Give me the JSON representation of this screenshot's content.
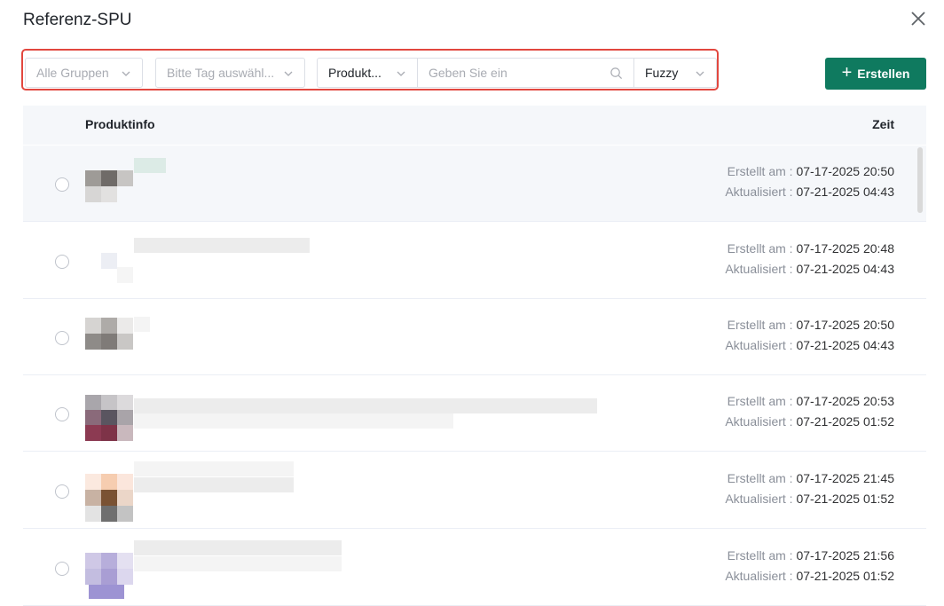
{
  "dialog": {
    "title": "Referenz-SPU"
  },
  "filters": {
    "group_select": "Alle Gruppen",
    "tag_select": "Bitte Tag auswähl...",
    "field_select": "Produkt...",
    "search_placeholder": "Geben Sie ein",
    "match_select": "Fuzzy"
  },
  "toolbar": {
    "create_label": "Erstellen",
    "create_icon": "plus-icon"
  },
  "table": {
    "headers": {
      "info": "Produktinfo",
      "time": "Zeit"
    },
    "created_label": "Erstellt am :",
    "updated_label": "Aktualisiert :",
    "rows": [
      {
        "created": "07-17-2025 20:50",
        "updated": "07-21-2025 04:43"
      },
      {
        "created": "07-17-2025 20:48",
        "updated": "07-21-2025 04:43"
      },
      {
        "created": "07-17-2025 20:50",
        "updated": "07-21-2025 04:43"
      },
      {
        "created": "07-17-2025 20:53",
        "updated": "07-21-2025 01:52"
      },
      {
        "created": "07-17-2025 21:45",
        "updated": "07-21-2025 01:52"
      },
      {
        "created": "07-17-2025 21:56",
        "updated": "07-21-2025 01:52"
      }
    ]
  },
  "colors": {
    "accent": "#0f7a5f",
    "highlight": "#e2473f",
    "header_bg": "#f5f7fa"
  }
}
